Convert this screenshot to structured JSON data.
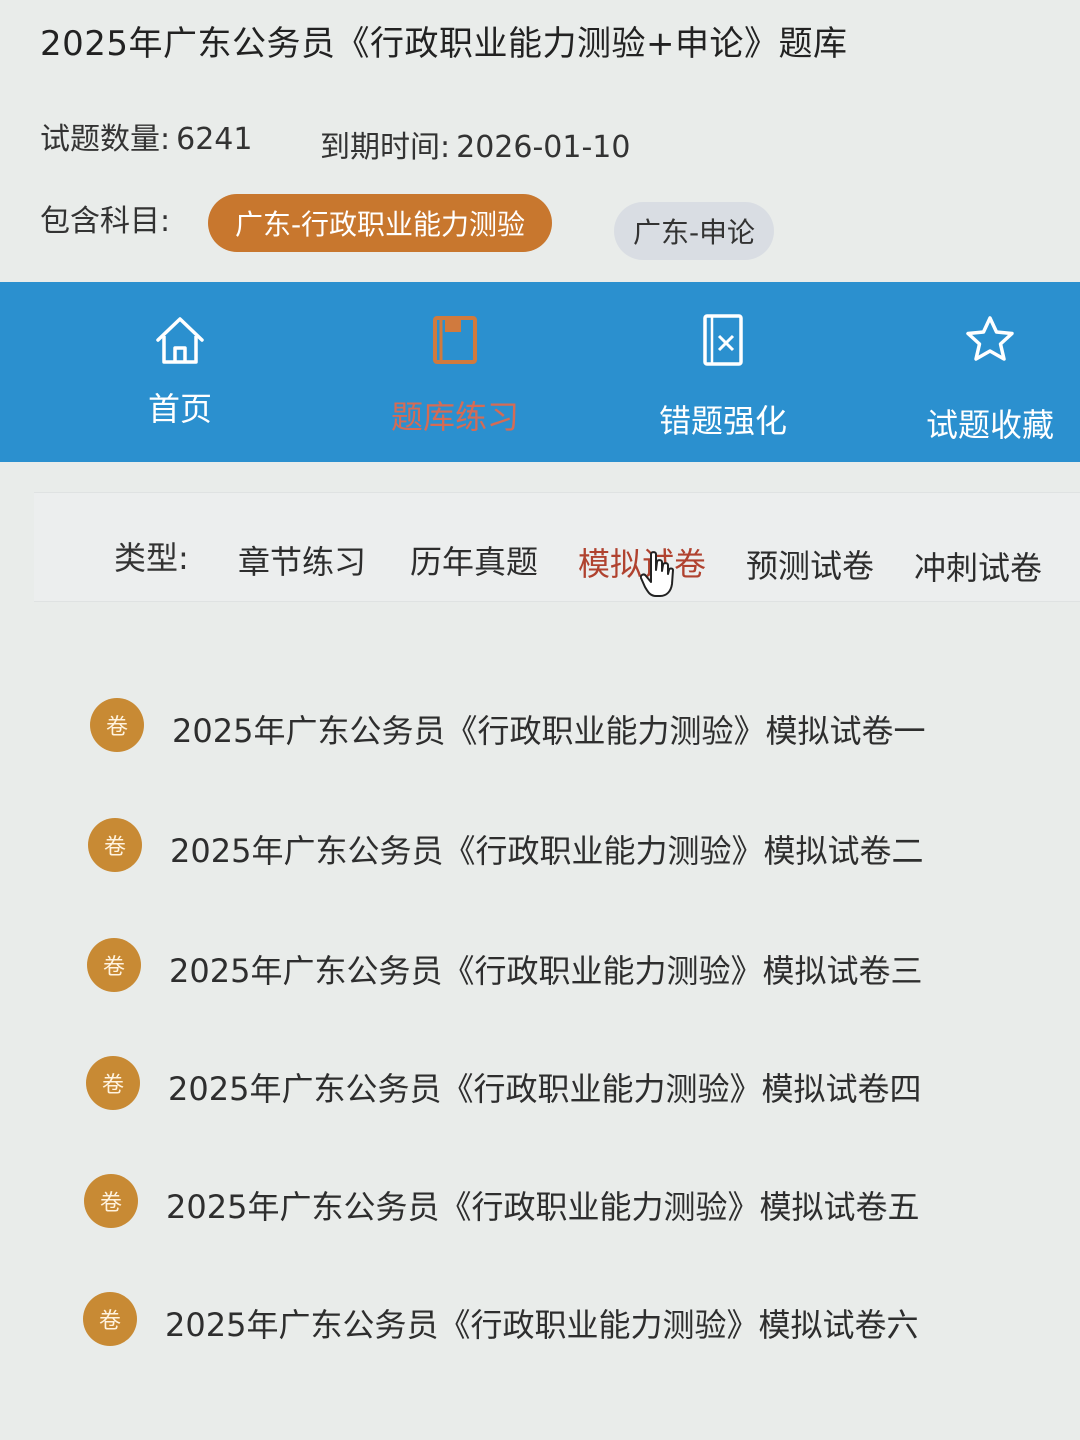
{
  "header": {
    "title": "2025年广东公务员《行政职业能力测验+申论》题库",
    "question_count_label": "试题数量:",
    "question_count": "6241",
    "expire_label": "到期时间:",
    "expire_date": "2026-01-10",
    "subjects_label": "包含科目:",
    "subjects": [
      {
        "label": "广东-行政职业能力测验",
        "selected": true
      },
      {
        "label": "广东-申论",
        "selected": false
      }
    ]
  },
  "nav": {
    "items": [
      {
        "label": "首页",
        "icon": "home-icon"
      },
      {
        "label": "题库练习",
        "icon": "book-icon",
        "active": true
      },
      {
        "label": "错题强化",
        "icon": "wrong-doc-icon"
      },
      {
        "label": "试题收藏",
        "icon": "star-icon"
      }
    ]
  },
  "filter": {
    "label": "类型:",
    "options": [
      "章节练习",
      "历年真题",
      "模拟试卷",
      "预测试卷",
      "冲刺试卷"
    ],
    "selected": "模拟试卷"
  },
  "papers": {
    "badge": "卷",
    "items": [
      "2025年广东公务员《行政职业能力测验》模拟试卷一",
      "2025年广东公务员《行政职业能力测验》模拟试卷二",
      "2025年广东公务员《行政职业能力测验》模拟试卷三",
      "2025年广东公务员《行政职业能力测验》模拟试卷四",
      "2025年广东公务员《行政职业能力测验》模拟试卷五",
      "2025年广东公务员《行政职业能力测验》模拟试卷六"
    ]
  },
  "colors": {
    "accent_orange": "#c8772e",
    "nav_blue": "#2b90cf",
    "selected_red": "#b0422f",
    "badge_gold": "#c88a34"
  }
}
